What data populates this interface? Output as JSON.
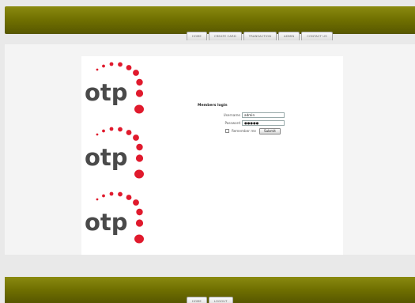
{
  "header": {
    "nav": [
      "HOME",
      "CREATE CARD",
      "TRANSACTION",
      "ADMIN",
      "CONTACT US"
    ]
  },
  "logo": {
    "text": "otp",
    "count": 3,
    "color": "#e01a2d"
  },
  "login": {
    "title": "Members login",
    "username_label": "Username",
    "username_value": "admin",
    "password_label": "Password",
    "password_value": "●●●●●",
    "remember_label": "Remember me",
    "submit_label": "Submit"
  },
  "footer": {
    "nav": [
      "HOME",
      "LOGOUT"
    ]
  },
  "colors": {
    "bar": "#6f6f00",
    "accent": "#e01a2d"
  }
}
